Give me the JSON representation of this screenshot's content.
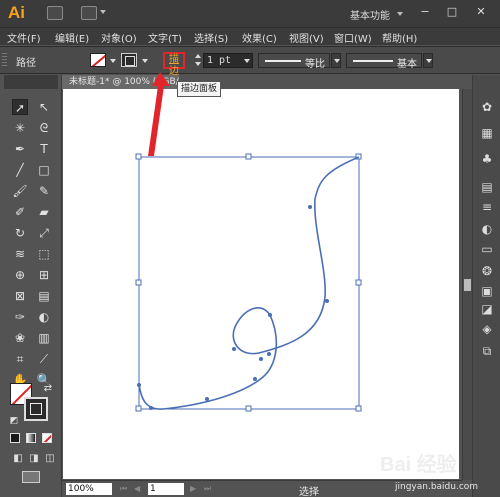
{
  "app": {
    "logo": "Ai",
    "workspace": "基本功能",
    "window_controls": [
      "−",
      "□",
      "✕"
    ]
  },
  "menu": [
    "文件(F)",
    "编辑(E)",
    "对象(O)",
    "文字(T)",
    "选择(S)",
    "效果(C)",
    "视图(V)",
    "窗口(W)",
    "帮助(H)"
  ],
  "options_bar": {
    "selection_type": "路径",
    "stroke_link": "描边",
    "stroke_weight": "1 pt",
    "profile_label": "等比",
    "brush_label": "基本"
  },
  "tooltip": "描边面板",
  "document_tab": "未标题-1* @ 100% (RGB/预览)",
  "status_bar": {
    "zoom": "100%",
    "page": "1",
    "tool_status": "选择"
  },
  "colors": {
    "accent_orange": "#f7a21b",
    "highlight_red": "#e0262c",
    "path_blue": "#4a6fb5"
  },
  "toolbox_icons": [
    "selection-tool",
    "direct-selection-tool",
    "magic-wand-tool",
    "lasso-tool",
    "pen-tool",
    "type-tool",
    "line-tool",
    "rectangle-tool",
    "paintbrush-tool",
    "pencil-tool",
    "blob-brush-tool",
    "eraser-tool",
    "rotate-tool",
    "scale-tool",
    "width-tool",
    "free-transform-tool",
    "shape-builder-tool",
    "perspective-grid-tool",
    "mesh-tool",
    "gradient-tool",
    "eyedropper-tool",
    "blend-tool",
    "symbol-sprayer-tool",
    "column-graph-tool",
    "artboard-tool",
    "slice-tool",
    "hand-tool",
    "zoom-tool"
  ],
  "right_panel_icons": [
    "color-icon",
    "color-guide-icon",
    "swatches-icon",
    "brushes-icon",
    "symbols-icon",
    "stroke-icon",
    "gradient-icon",
    "transparency-icon",
    "appearance-icon",
    "graphic-styles-icon",
    "layers-icon",
    "artboards-icon"
  ],
  "watermark": {
    "text": "Bai 经验",
    "url": "jingyan.baidu.com"
  }
}
